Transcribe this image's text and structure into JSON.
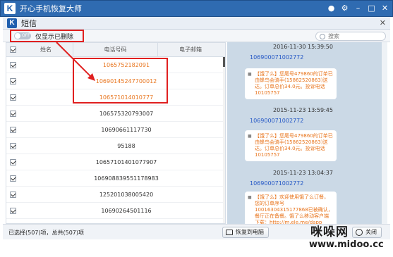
{
  "app": {
    "title": "开心手机恢复大师",
    "logo": "K"
  },
  "window": {
    "sub_title": "短信"
  },
  "toolbar": {
    "toggle_text": "OFF",
    "filter_label": "仅显示已删除",
    "search_placeholder": "搜索"
  },
  "table": {
    "headers": [
      "姓名",
      "电话号码",
      "电子邮箱"
    ],
    "rows": [
      {
        "number": "1065752182091",
        "deleted": true
      },
      {
        "number": "10690145247700012",
        "deleted": true
      },
      {
        "number": "106571014010777",
        "deleted": true
      },
      {
        "number": "106575320793007",
        "deleted": false
      },
      {
        "number": "10690661117730",
        "deleted": false
      },
      {
        "number": "95188",
        "deleted": false
      },
      {
        "number": "10657101401077907",
        "deleted": false
      },
      {
        "number": "106908839551178983",
        "deleted": false
      },
      {
        "number": "125201038005420",
        "deleted": false
      },
      {
        "number": "10690264501116",
        "deleted": false
      }
    ]
  },
  "messages": [
    {
      "timestamp": "2016-11-30 15:39:50",
      "sender": "106900071002772",
      "body": "【饿了么】您尾号479860的订单已由蜂鸟会骑手(15862520863)送达。订单总价34.0元。投诉电话10105757"
    },
    {
      "timestamp": "2015-11-23 13:59:45",
      "sender": "106900071002772",
      "body": "【饿了么】您尾号479860的订单已由蜂鸟会骑手(15862520863)送达。订单总价34.0元。投诉电话10105757"
    },
    {
      "timestamp": "2015-11-23 13:04:37",
      "sender": "106900071002772",
      "body": "【饿了么】欢迎使用饿了么订餐，您的订单序号10016304315177868已被确认，餐厅正在备餐。饿了么移动客户端下载：http://m.ele.me/dapp"
    }
  ],
  "footer": {
    "status": "已选择(507)项，总共(507)项",
    "restore_button": "恢复到电脑",
    "close_button": "关闭"
  },
  "watermark": {
    "site_cn": "咪哚网",
    "site_url": "www.midoo.cc"
  }
}
